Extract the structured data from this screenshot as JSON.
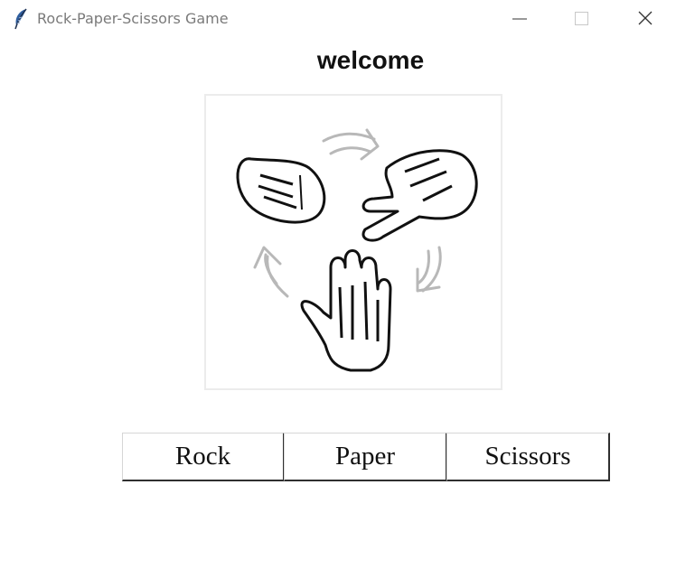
{
  "window": {
    "title": "Rock-Paper-Scissors Game",
    "app_icon": "feather-icon",
    "controls": {
      "minimize": "minimize-icon",
      "maximize": "maximize-icon",
      "close": "close-icon"
    }
  },
  "main": {
    "heading": "welcome",
    "illustration": [
      "rock-hand-icon",
      "scissors-hand-icon",
      "paper-hand-icon",
      "cycle-arrow-icon"
    ],
    "buttons": {
      "rock": "Rock",
      "paper": "Paper",
      "scissors": "Scissors"
    }
  },
  "colors": {
    "arrow_gray": "#b8b8b8",
    "frame_border": "#ececec",
    "button_shadow": "#2f2f2f"
  }
}
